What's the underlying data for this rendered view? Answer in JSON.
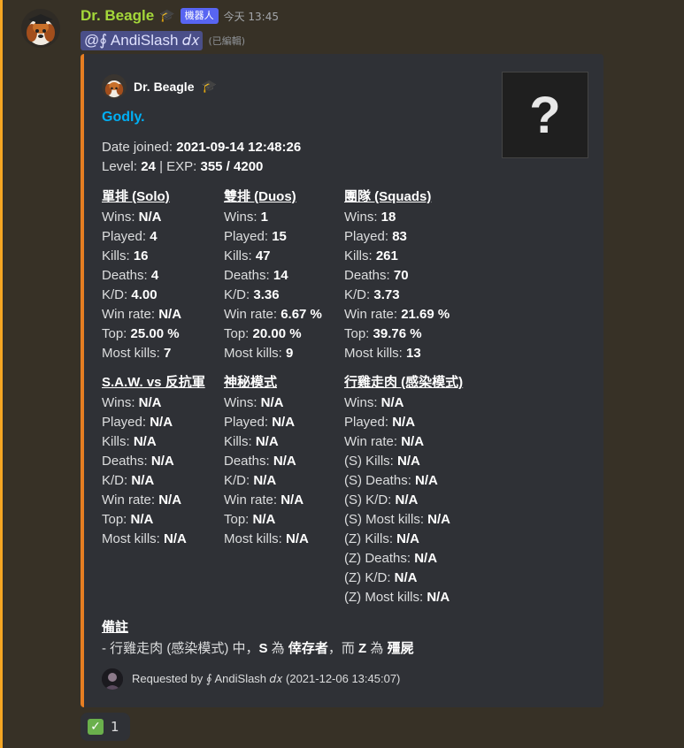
{
  "colors": {
    "accent": "#f4a623",
    "embed_border": "#e67e22",
    "username": "#a4d83a",
    "title": "#00aff4",
    "badge": "#5865f2"
  },
  "message": {
    "username": "Dr. Beagle",
    "bot_tag": "機器人",
    "timestamp": "今天 13:45",
    "mention": "@∮ AndiSlash 𝑑𝑥",
    "edited": "(已編輯)"
  },
  "embed": {
    "author": "Dr. Beagle",
    "title": "Godly.",
    "thumbnail": "?",
    "date_joined_label": "Date joined:",
    "date_joined": "2021-09-14 12:48:26",
    "level_label": "Level:",
    "level": "24",
    "exp_label": "| EXP:",
    "exp": "355 / 4200",
    "fields": [
      {
        "title": "單排 (Solo)",
        "rows": [
          {
            "label": "Wins:",
            "value": "N/A"
          },
          {
            "label": "Played:",
            "value": "4"
          },
          {
            "label": "Kills:",
            "value": "16"
          },
          {
            "label": "Deaths:",
            "value": "4"
          },
          {
            "label": "K/D:",
            "value": "4.00"
          },
          {
            "label": "Win rate:",
            "value": "N/A"
          },
          {
            "label": "Top:",
            "value": "25.00 %"
          },
          {
            "label": "Most kills:",
            "value": "7"
          }
        ]
      },
      {
        "title": "雙排 (Duos)",
        "rows": [
          {
            "label": "Wins:",
            "value": "1"
          },
          {
            "label": "Played:",
            "value": "15"
          },
          {
            "label": "Kills:",
            "value": "47"
          },
          {
            "label": "Deaths:",
            "value": "14"
          },
          {
            "label": "K/D:",
            "value": "3.36"
          },
          {
            "label": "Win rate:",
            "value": "6.67 %"
          },
          {
            "label": "Top:",
            "value": "20.00 %"
          },
          {
            "label": "Most kills:",
            "value": "9"
          }
        ]
      },
      {
        "title": "團隊 (Squads)",
        "rows": [
          {
            "label": "Wins:",
            "value": "18"
          },
          {
            "label": "Played:",
            "value": "83"
          },
          {
            "label": "Kills:",
            "value": "261"
          },
          {
            "label": "Deaths:",
            "value": "70"
          },
          {
            "label": "K/D:",
            "value": "3.73"
          },
          {
            "label": "Win rate:",
            "value": "21.69 %"
          },
          {
            "label": "Top:",
            "value": "39.76 %"
          },
          {
            "label": "Most kills:",
            "value": "13"
          }
        ]
      },
      {
        "title": "S.A.W. vs 反抗軍",
        "rows": [
          {
            "label": "Wins:",
            "value": "N/A"
          },
          {
            "label": "Played:",
            "value": "N/A"
          },
          {
            "label": "Kills:",
            "value": "N/A"
          },
          {
            "label": "Deaths:",
            "value": "N/A"
          },
          {
            "label": "K/D:",
            "value": "N/A"
          },
          {
            "label": "Win rate:",
            "value": "N/A"
          },
          {
            "label": "Top:",
            "value": "N/A"
          },
          {
            "label": "Most kills:",
            "value": "N/A"
          }
        ]
      },
      {
        "title": "神秘模式",
        "rows": [
          {
            "label": "Wins:",
            "value": "N/A"
          },
          {
            "label": "Played:",
            "value": "N/A"
          },
          {
            "label": "Kills:",
            "value": "N/A"
          },
          {
            "label": "Deaths:",
            "value": "N/A"
          },
          {
            "label": "K/D:",
            "value": "N/A"
          },
          {
            "label": "Win rate:",
            "value": "N/A"
          },
          {
            "label": "Top:",
            "value": "N/A"
          },
          {
            "label": "Most kills:",
            "value": "N/A"
          }
        ]
      },
      {
        "title": "行雞走肉 (感染模式)",
        "rows": [
          {
            "label": "Wins:",
            "value": "N/A"
          },
          {
            "label": "Played:",
            "value": "N/A"
          },
          {
            "label": "Win rate:",
            "value": "N/A"
          },
          {
            "label": "(S) Kills:",
            "value": "N/A"
          },
          {
            "label": "(S) Deaths:",
            "value": "N/A"
          },
          {
            "label": "(S) K/D:",
            "value": "N/A"
          },
          {
            "label": "(S) Most kills:",
            "value": "N/A"
          },
          {
            "label": "(Z) Kills:",
            "value": "N/A"
          },
          {
            "label": "(Z) Deaths:",
            "value": "N/A"
          },
          {
            "label": "(Z) K/D:",
            "value": "N/A"
          },
          {
            "label": "(Z) Most kills:",
            "value": "N/A"
          }
        ]
      }
    ],
    "note_title": "備註",
    "note": {
      "prefix": "- 行雞走肉 (感染模式) 中，",
      "s": "S",
      "mid1": " 為 ",
      "survivor": "倖存者",
      "mid2": "，而 ",
      "z": "Z",
      "mid3": " 為 ",
      "zombie": "殭屍"
    },
    "footer": "Requested by ∮ AndiSlash 𝑑𝑥 (2021-12-06 13:45:07)"
  },
  "reaction": {
    "icon": "check-icon",
    "count": "1"
  }
}
